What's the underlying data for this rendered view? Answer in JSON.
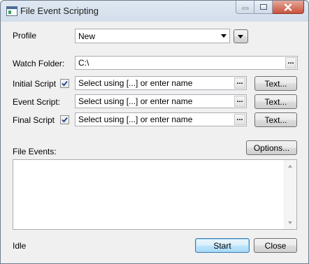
{
  "window": {
    "title": "File Event Scripting"
  },
  "profile": {
    "label": "Profile",
    "value": "New"
  },
  "watch_folder": {
    "label": "Watch Folder:",
    "value": "C:\\",
    "browse": "..."
  },
  "initial_script": {
    "label": "Initial Script",
    "checked": true,
    "value": "Select using [...] or enter name",
    "browse": "...",
    "text_button": "Text..."
  },
  "event_script": {
    "label": "Event Script:",
    "value": "Select using [...] or enter name",
    "browse": "...",
    "text_button": "Text..."
  },
  "final_script": {
    "label": "Final Script",
    "checked": true,
    "value": "Select using [...] or enter name",
    "browse": "...",
    "text_button": "Text..."
  },
  "options_button": "Options...",
  "file_events": {
    "label": "File Events:",
    "items": []
  },
  "status": "Idle",
  "start_button": "Start",
  "close_button": "Close",
  "icons": {
    "app": "app-window-icon",
    "minimize": "minimize-icon",
    "maximize": "maximize-icon",
    "close": "close-icon",
    "check": "checkmark-icon",
    "dropdown": "chevron-down-icon"
  }
}
